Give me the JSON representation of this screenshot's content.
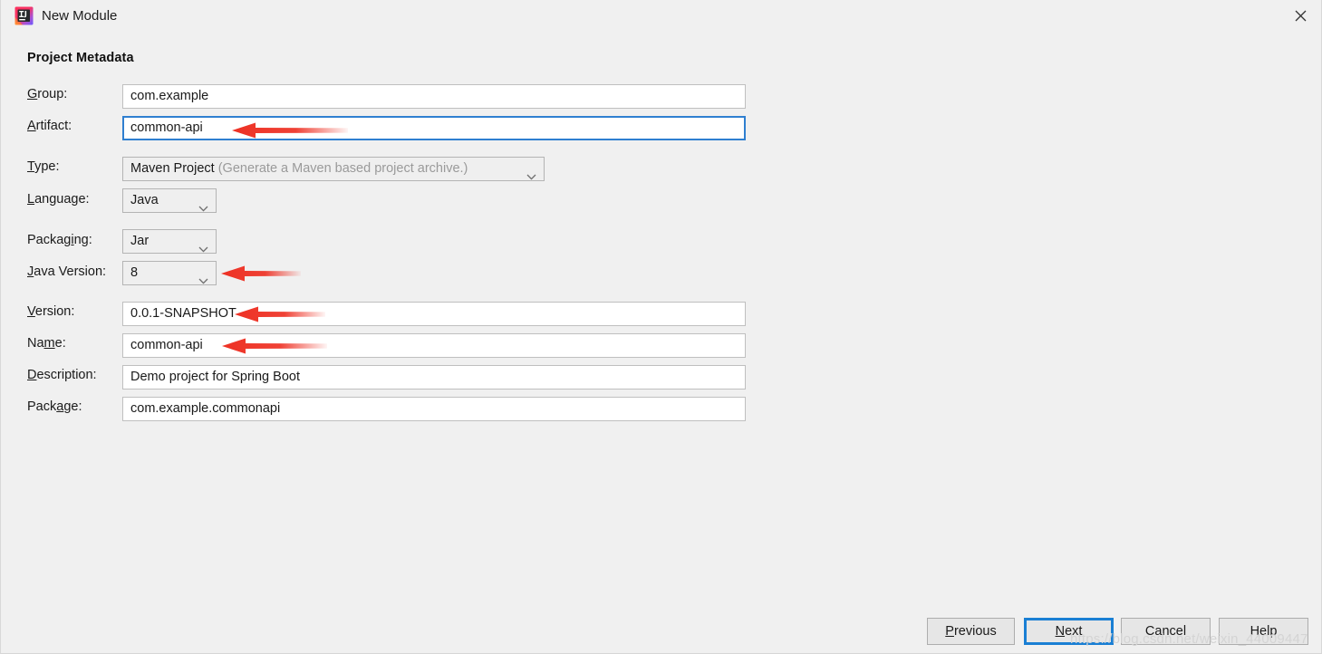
{
  "window": {
    "title": "New Module",
    "app_icon": "intellij-idea-icon",
    "close_icon": "close-icon"
  },
  "section": {
    "title": "Project Metadata"
  },
  "fields": [
    {
      "key": "group",
      "label": "Group:",
      "mnemonic_index": 0,
      "control": "text",
      "value": "com.example",
      "focused": false,
      "annotated": false
    },
    {
      "key": "artifact",
      "label": "Artifact:",
      "mnemonic_index": 0,
      "control": "text",
      "value": "common-api",
      "focused": true,
      "annotated": true
    },
    {
      "key": "type",
      "label": "Type:",
      "mnemonic_index": 0,
      "control": "combo",
      "value": "Maven Project",
      "hint": "(Generate a Maven based project archive.)",
      "focused": false,
      "annotated": false
    },
    {
      "key": "language",
      "label": "Language:",
      "mnemonic_index": 0,
      "control": "combo",
      "value": "Java",
      "hint": "",
      "focused": false,
      "annotated": false
    },
    {
      "key": "packaging",
      "label": "Packaging:",
      "mnemonic_index": 6,
      "control": "combo",
      "value": "Jar",
      "hint": "",
      "focused": false,
      "annotated": false
    },
    {
      "key": "java_version",
      "label": "Java Version:",
      "mnemonic_index": 0,
      "control": "combo",
      "value": "8",
      "hint": "",
      "focused": false,
      "annotated": true
    },
    {
      "key": "version",
      "label": "Version:",
      "mnemonic_index": 0,
      "control": "text",
      "value": "0.0.1-SNAPSHOT",
      "focused": false,
      "annotated": true
    },
    {
      "key": "name",
      "label": "Name:",
      "mnemonic_index": 2,
      "control": "text",
      "value": "common-api",
      "focused": false,
      "annotated": true
    },
    {
      "key": "description",
      "label": "Description:",
      "mnemonic_index": 0,
      "control": "text",
      "value": "Demo project for Spring Boot",
      "focused": false,
      "annotated": false
    },
    {
      "key": "package",
      "label": "Package:",
      "mnemonic_index": 4,
      "control": "text",
      "value": "com.example.commonapi",
      "focused": false,
      "annotated": false
    }
  ],
  "buttons": [
    {
      "key": "previous",
      "label": "Previous",
      "mnemonic_index": 0,
      "default": false
    },
    {
      "key": "next",
      "label": "Next",
      "mnemonic_index": 0,
      "default": true
    },
    {
      "key": "cancel",
      "label": "Cancel",
      "mnemonic_index": -1,
      "default": false
    },
    {
      "key": "help",
      "label": "Help",
      "mnemonic_index": -1,
      "default": false
    }
  ],
  "watermark": {
    "text": "https://blog.csdn.net/weixin_44009447"
  },
  "colors": {
    "background": "#f0f0f0",
    "focus_blue": "#2f7fd0",
    "default_button_blue": "#1a7fd4",
    "annotation_red": "#ee3124",
    "text": "#1a1a1a",
    "hint_text": "#9a9a9a",
    "watermark": "#d4d4d4"
  }
}
